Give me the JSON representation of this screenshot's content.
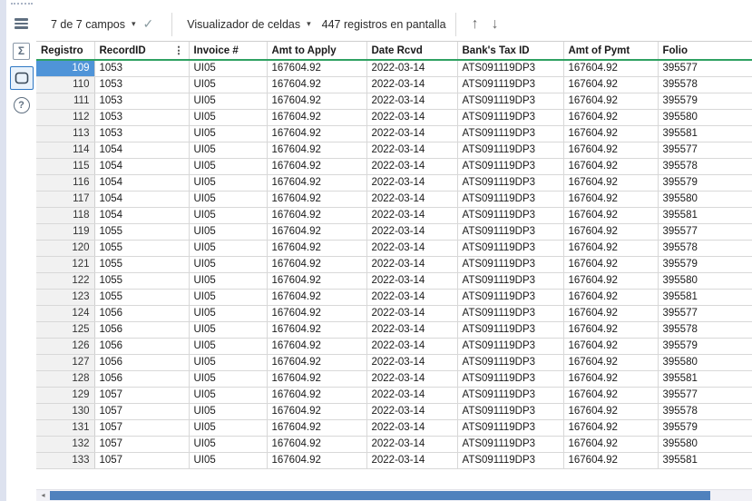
{
  "toolbar": {
    "fields_dropdown": "7 de 7 campos",
    "cell_viewer_dropdown": "Visualizador de celdas",
    "records_label": "447 registros en pantalla"
  },
  "rail": {
    "sigma_glyph": "Σ",
    "help_glyph": "?"
  },
  "icons": {
    "caret_down": "▾",
    "check": "✓",
    "arrow_up": "↑",
    "arrow_down": "↓",
    "scroll_left": "◂",
    "column_menu": "⋮"
  },
  "colors": {
    "selection_blue": "#4f94d8",
    "header_underline_green": "#2fa162",
    "scroll_thumb_blue": "#4f81bd"
  },
  "table": {
    "columns": [
      "Registro",
      "RecordID",
      "Invoice #",
      "Amt to Apply",
      "Date Rcvd",
      "Bank's Tax ID",
      "Amt of Pymt",
      "Folio"
    ],
    "column_menu_on": "RecordID",
    "selected_row_index": 0,
    "rows": [
      [
        "109",
        "1053",
        "UI05",
        "167604.92",
        "2022-03-14",
        "ATS091119DP3",
        "167604.92",
        "395577"
      ],
      [
        "110",
        "1053",
        "UI05",
        "167604.92",
        "2022-03-14",
        "ATS091119DP3",
        "167604.92",
        "395578"
      ],
      [
        "111",
        "1053",
        "UI05",
        "167604.92",
        "2022-03-14",
        "ATS091119DP3",
        "167604.92",
        "395579"
      ],
      [
        "112",
        "1053",
        "UI05",
        "167604.92",
        "2022-03-14",
        "ATS091119DP3",
        "167604.92",
        "395580"
      ],
      [
        "113",
        "1053",
        "UI05",
        "167604.92",
        "2022-03-14",
        "ATS091119DP3",
        "167604.92",
        "395581"
      ],
      [
        "114",
        "1054",
        "UI05",
        "167604.92",
        "2022-03-14",
        "ATS091119DP3",
        "167604.92",
        "395577"
      ],
      [
        "115",
        "1054",
        "UI05",
        "167604.92",
        "2022-03-14",
        "ATS091119DP3",
        "167604.92",
        "395578"
      ],
      [
        "116",
        "1054",
        "UI05",
        "167604.92",
        "2022-03-14",
        "ATS091119DP3",
        "167604.92",
        "395579"
      ],
      [
        "117",
        "1054",
        "UI05",
        "167604.92",
        "2022-03-14",
        "ATS091119DP3",
        "167604.92",
        "395580"
      ],
      [
        "118",
        "1054",
        "UI05",
        "167604.92",
        "2022-03-14",
        "ATS091119DP3",
        "167604.92",
        "395581"
      ],
      [
        "119",
        "1055",
        "UI05",
        "167604.92",
        "2022-03-14",
        "ATS091119DP3",
        "167604.92",
        "395577"
      ],
      [
        "120",
        "1055",
        "UI05",
        "167604.92",
        "2022-03-14",
        "ATS091119DP3",
        "167604.92",
        "395578"
      ],
      [
        "121",
        "1055",
        "UI05",
        "167604.92",
        "2022-03-14",
        "ATS091119DP3",
        "167604.92",
        "395579"
      ],
      [
        "122",
        "1055",
        "UI05",
        "167604.92",
        "2022-03-14",
        "ATS091119DP3",
        "167604.92",
        "395580"
      ],
      [
        "123",
        "1055",
        "UI05",
        "167604.92",
        "2022-03-14",
        "ATS091119DP3",
        "167604.92",
        "395581"
      ],
      [
        "124",
        "1056",
        "UI05",
        "167604.92",
        "2022-03-14",
        "ATS091119DP3",
        "167604.92",
        "395577"
      ],
      [
        "125",
        "1056",
        "UI05",
        "167604.92",
        "2022-03-14",
        "ATS091119DP3",
        "167604.92",
        "395578"
      ],
      [
        "126",
        "1056",
        "UI05",
        "167604.92",
        "2022-03-14",
        "ATS091119DP3",
        "167604.92",
        "395579"
      ],
      [
        "127",
        "1056",
        "UI05",
        "167604.92",
        "2022-03-14",
        "ATS091119DP3",
        "167604.92",
        "395580"
      ],
      [
        "128",
        "1056",
        "UI05",
        "167604.92",
        "2022-03-14",
        "ATS091119DP3",
        "167604.92",
        "395581"
      ],
      [
        "129",
        "1057",
        "UI05",
        "167604.92",
        "2022-03-14",
        "ATS091119DP3",
        "167604.92",
        "395577"
      ],
      [
        "130",
        "1057",
        "UI05",
        "167604.92",
        "2022-03-14",
        "ATS091119DP3",
        "167604.92",
        "395578"
      ],
      [
        "131",
        "1057",
        "UI05",
        "167604.92",
        "2022-03-14",
        "ATS091119DP3",
        "167604.92",
        "395579"
      ],
      [
        "132",
        "1057",
        "UI05",
        "167604.92",
        "2022-03-14",
        "ATS091119DP3",
        "167604.92",
        "395580"
      ],
      [
        "133",
        "1057",
        "UI05",
        "167604.92",
        "2022-03-14",
        "ATS091119DP3",
        "167604.92",
        "395581"
      ]
    ]
  }
}
